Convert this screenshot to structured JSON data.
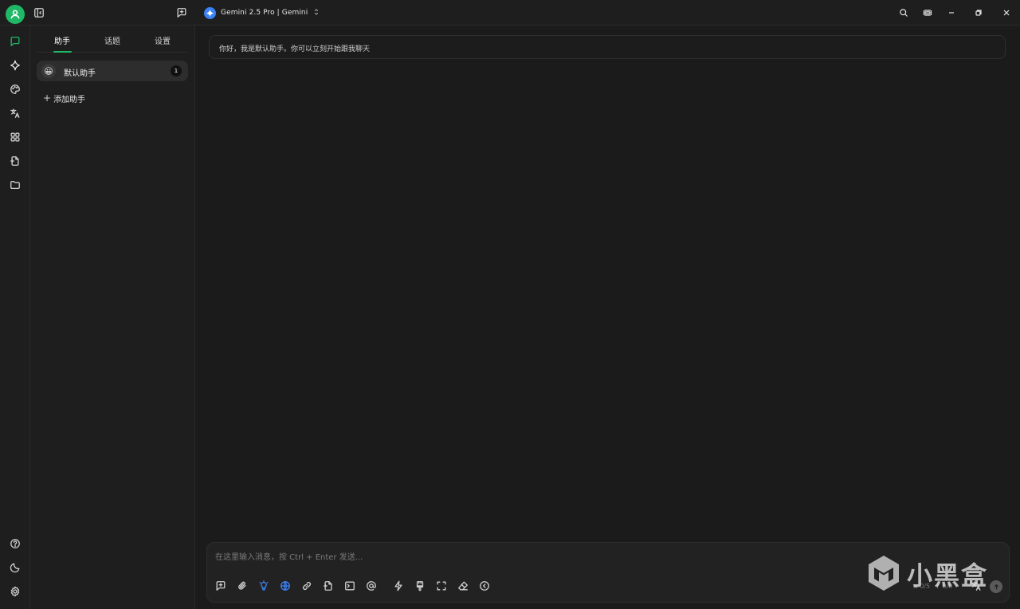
{
  "topbar": {
    "model_name": "Gemini 2.5 Pro | Gemini",
    "icons": [
      "user-avatar-icon",
      "sidebar-toggle-icon",
      "new-topic-icon",
      "search-icon",
      "layout-icon",
      "minimize-icon",
      "restore-icon",
      "close-icon"
    ]
  },
  "rail": {
    "items": [
      "chat-icon",
      "sparkle-icon",
      "palette-icon",
      "translate-icon",
      "apps-icon",
      "file-icon",
      "folder-icon"
    ],
    "bottom": [
      "help-icon",
      "moon-icon",
      "settings-icon"
    ]
  },
  "panel": {
    "tabs": [
      {
        "label": "助手"
      },
      {
        "label": "话题"
      },
      {
        "label": "设置"
      }
    ],
    "assistants": [
      {
        "name": "默认助手",
        "emoji": "😀",
        "count": "1"
      }
    ],
    "add_label": "添加助手",
    "add_symbol": "+"
  },
  "chat": {
    "welcome": "你好，我是默认助手。你可以立刻开始跟我聊天"
  },
  "composer": {
    "placeholder": "在这里输入消息，按 Ctrl + Enter 发送...",
    "tokens_context": "≡ 0/5",
    "tokens_io": "↑ 0/0"
  },
  "watermark": {
    "text": "小黑盒"
  },
  "colors": {
    "accent": "#1fb866",
    "background": "#1b1b1b",
    "panel": "#1e1e1e",
    "model_logo": "#3b82f6"
  }
}
